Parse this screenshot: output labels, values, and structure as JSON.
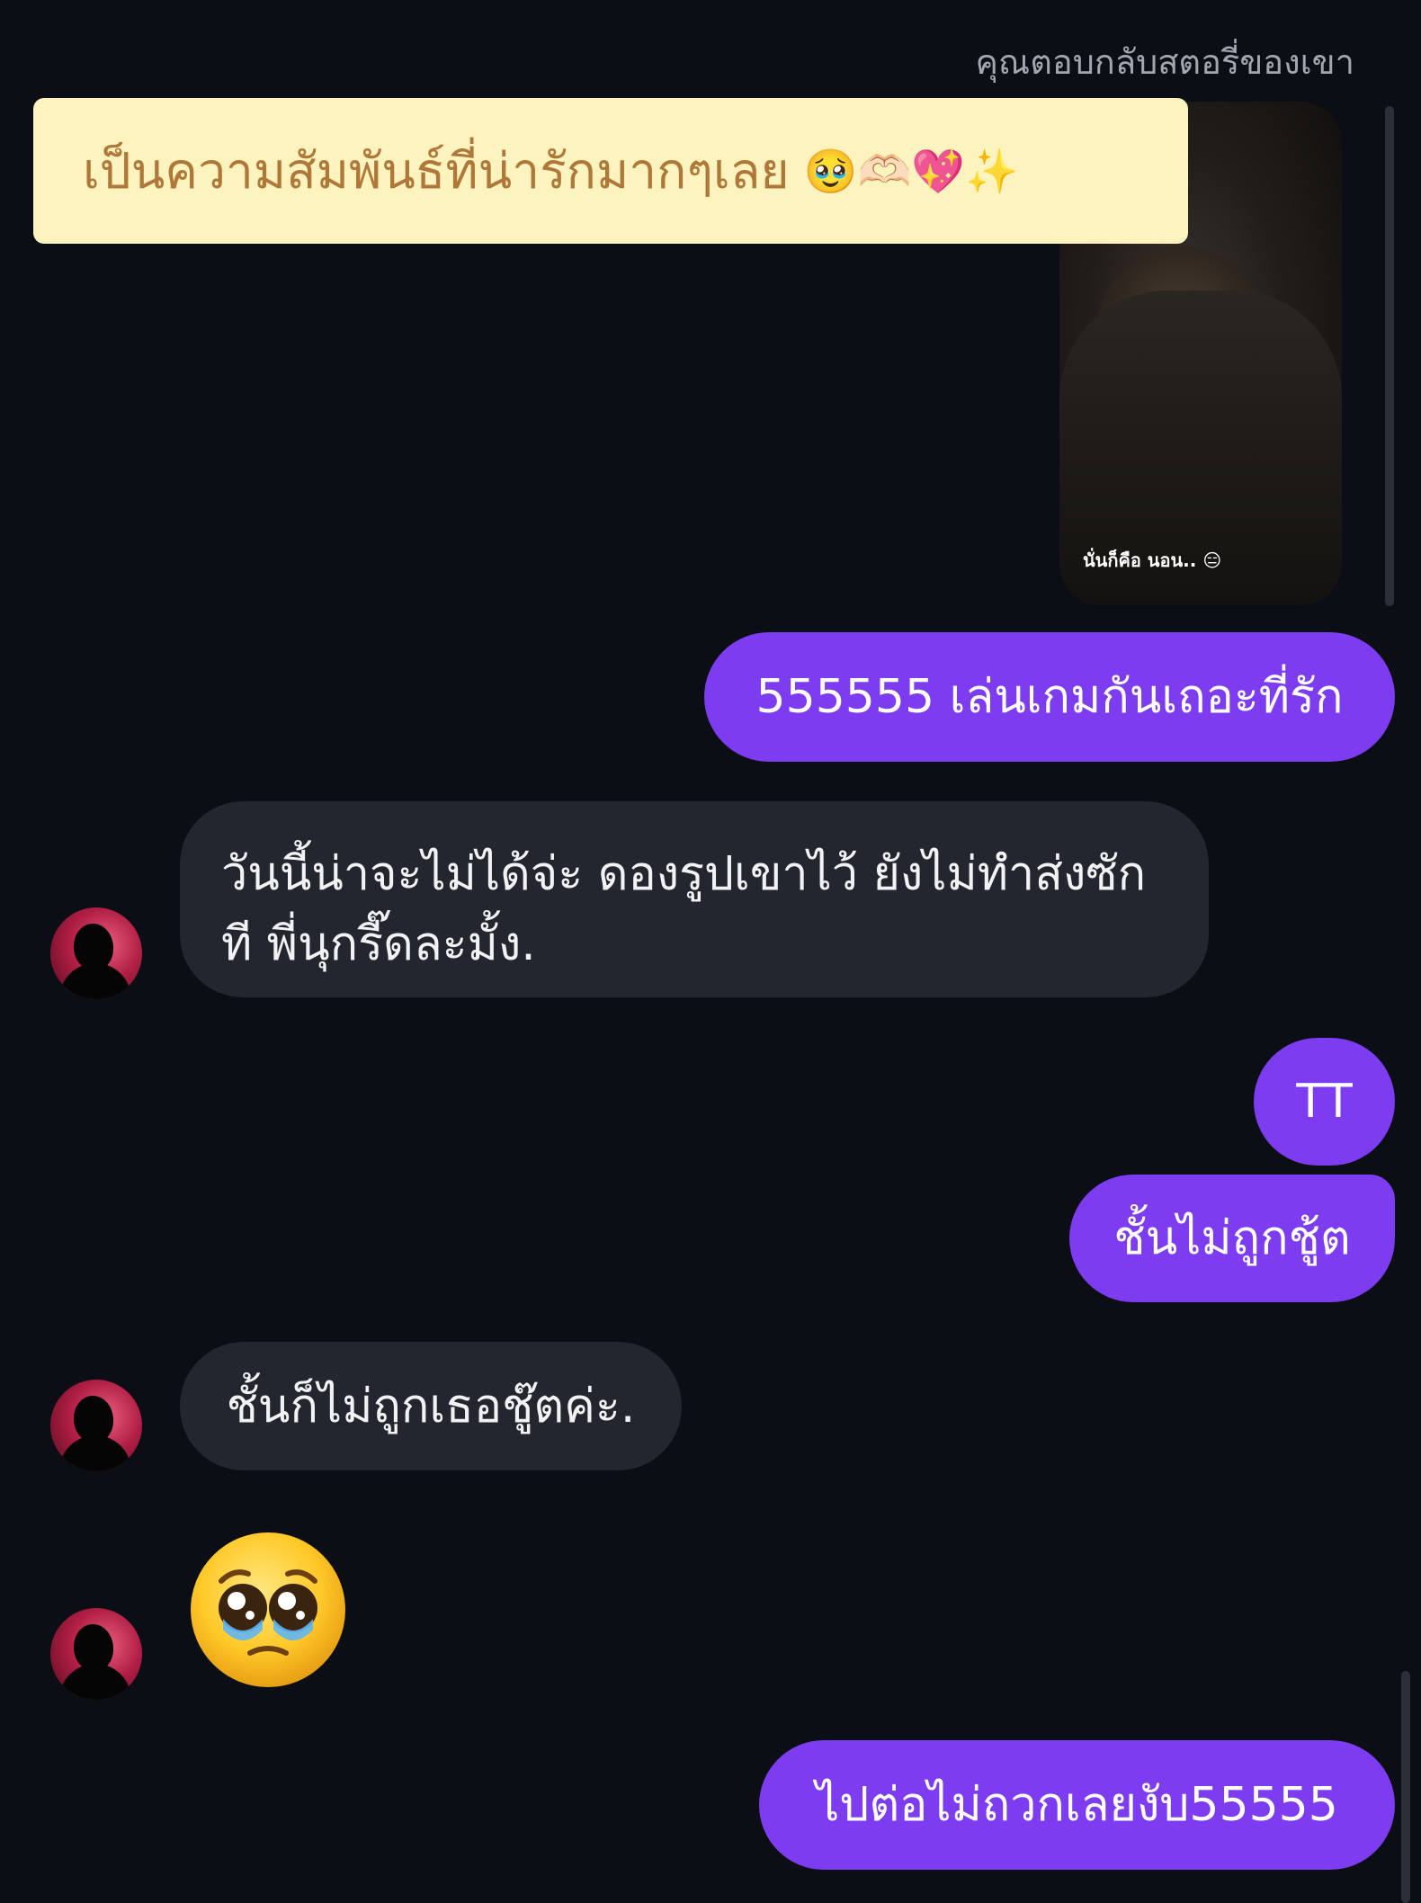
{
  "header": {
    "story_reply_label": "คุณตอบกลับสตอรี่ของเขา"
  },
  "overlay_caption": {
    "text": "เป็นความสัมพันธ์ที่น่ารักมากๆเลย",
    "emojis": "🥹🫶🏻💖✨"
  },
  "story": {
    "caption": "นั่นก็คือ นอน.. 😑"
  },
  "messages": [
    {
      "sender": "me",
      "text": "555555 เล่นเกมกันเถอะที่รัก"
    },
    {
      "sender": "them",
      "text": "วันนี้น่าจะไม่ได้จ่ะ ดองรูปเขาไว้ ยังไม่ทำส่งซักที พี่นุกรี๊ดละมั้ง."
    },
    {
      "sender": "me",
      "text": "TT"
    },
    {
      "sender": "me",
      "text": "ชั้นไม่ถูกชู้ต"
    },
    {
      "sender": "them",
      "text": "ชั้นก็ไม่ถูกเธอชู๊ตค่ะ."
    },
    {
      "sender": "them",
      "text": "🥹"
    },
    {
      "sender": "me",
      "text": "ไปต่อไม่ถวกเลยงับ55555"
    }
  ],
  "colors": {
    "background": "#0c0e15",
    "outgoing_bubble": "#7d3cf0",
    "incoming_bubble": "#23262f",
    "banner": "#fcf3bf",
    "banner_text": "#b07838"
  },
  "icons": {
    "contact_avatar": "person-silhouette-avatar"
  }
}
